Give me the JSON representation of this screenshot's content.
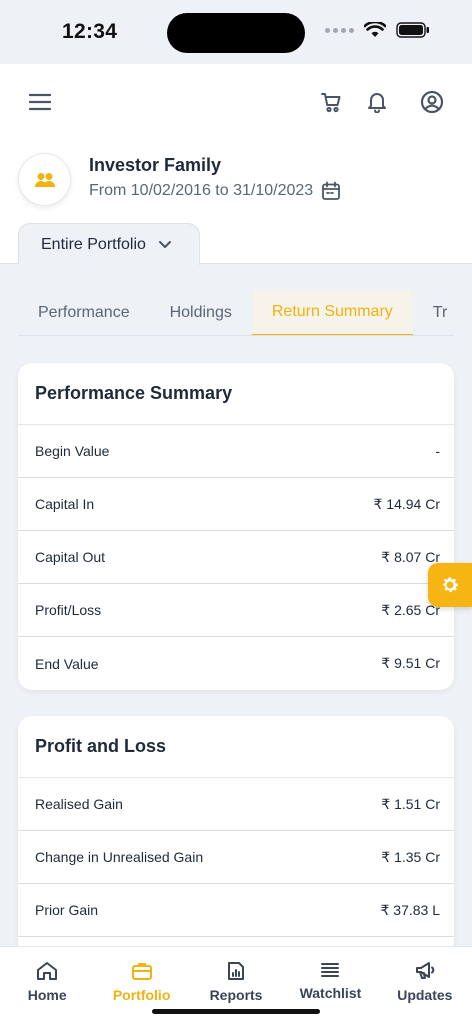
{
  "status": {
    "time": "12:34"
  },
  "header": {
    "icons": [
      "menu-icon",
      "cart-icon",
      "bell-icon",
      "user-circle-icon"
    ]
  },
  "profile": {
    "name": "Investor Family",
    "date_range": "From 10/02/2016 to 31/10/2023"
  },
  "portfolio_selector": {
    "label": "Entire Portfolio"
  },
  "tabs": [
    {
      "label": "Performance",
      "active": false
    },
    {
      "label": "Holdings",
      "active": false
    },
    {
      "label": "Return Summary",
      "active": true
    },
    {
      "label": "Tr",
      "active": false
    }
  ],
  "performance_summary": {
    "title": "Performance Summary",
    "rows": [
      {
        "label": "Begin Value",
        "value": "-"
      },
      {
        "label": "Capital In",
        "value": "₹ 14.94 Cr"
      },
      {
        "label": "Capital Out",
        "value": "₹ 8.07 Cr"
      },
      {
        "label": "Profit/Loss",
        "value": "₹ 2.65 Cr"
      },
      {
        "label": "End Value",
        "value": "₹ 9.51 Cr"
      }
    ]
  },
  "profit_and_loss": {
    "title": "Profit and Loss",
    "rows": [
      {
        "label": "Realised Gain",
        "value": "₹ 1.51 Cr"
      },
      {
        "label": "Change in Unrealised Gain",
        "value": "₹ 1.35 Cr"
      },
      {
        "label": "Prior Gain",
        "value": "₹ 37.83 L"
      }
    ]
  },
  "bottom_nav": [
    {
      "label": "Home",
      "icon": "home-icon",
      "active": false
    },
    {
      "label": "Portfolio",
      "icon": "briefcase-icon",
      "active": true
    },
    {
      "label": "Reports",
      "icon": "report-icon",
      "active": false
    },
    {
      "label": "Watchlist",
      "icon": "list-icon",
      "active": false
    },
    {
      "label": "Updates",
      "icon": "megaphone-icon",
      "active": false
    }
  ],
  "colors": {
    "accent": "#f2b20f",
    "text": "#1f2a3a",
    "muted": "#5a6678",
    "background": "#eef1f6"
  }
}
